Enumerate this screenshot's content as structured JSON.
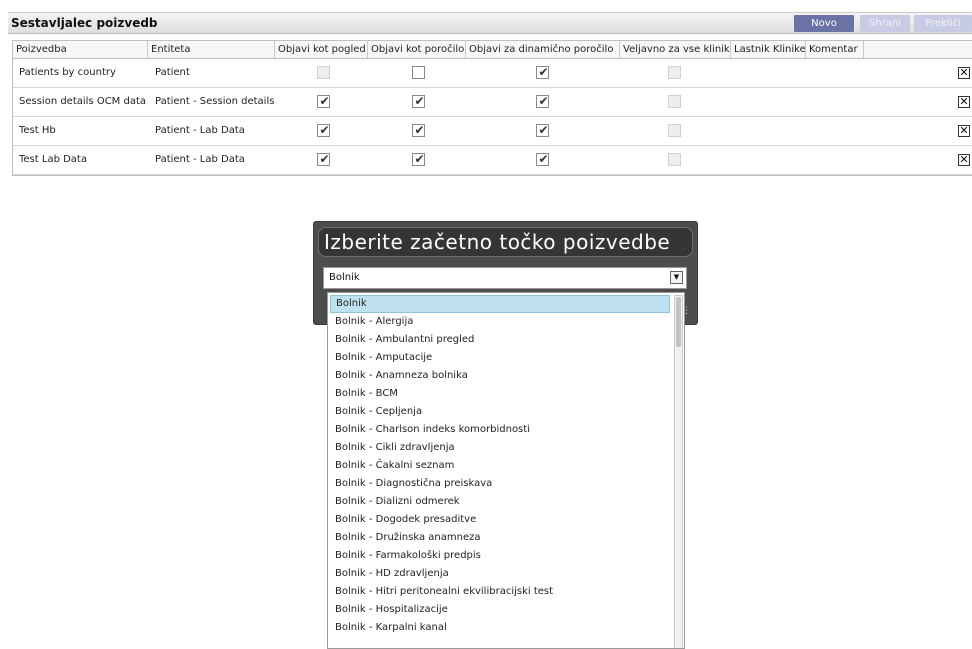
{
  "app": {
    "title": "Sestavljalec poizvedb",
    "buttons": {
      "new": "Novo",
      "save": "Shrani",
      "cancel": "Prekliči"
    }
  },
  "grid": {
    "columns": [
      "Poizvedba",
      "Entiteta",
      "Objavi kot pogled",
      "Objavi kot poročilo",
      "Objavi za dinamično poročilo",
      "Veljavno za vse klinike",
      "Lastnik Klinike",
      "Komentar"
    ],
    "rows": [
      {
        "query": "Patients by country",
        "entity": "Patient",
        "view": false,
        "view_disabled": true,
        "report": false,
        "dynamic": true,
        "all_clinics": false
      },
      {
        "query": "Session details OCM data",
        "entity": "Patient - Session details",
        "view": true,
        "view_disabled": false,
        "report": true,
        "dynamic": true,
        "all_clinics": false
      },
      {
        "query": "Test Hb",
        "entity": "Patient - Lab Data",
        "view": true,
        "view_disabled": false,
        "report": true,
        "dynamic": true,
        "all_clinics": false
      },
      {
        "query": "Test Lab Data",
        "entity": "Patient - Lab Data",
        "view": true,
        "view_disabled": false,
        "report": true,
        "dynamic": true,
        "all_clinics": false
      }
    ],
    "delete_glyph": "✕"
  },
  "dialog": {
    "title": "Izberite začetno točko poizvedbe",
    "selected": "Bolnik",
    "options": [
      "Bolnik",
      "Bolnik - Alergija",
      "Bolnik - Ambulantni pregled",
      "Bolnik - Amputacije",
      "Bolnik - Anamneza bolnika",
      "Bolnik - BCM",
      "Bolnik - Cepljenja",
      "Bolnik - Charlson indeks komorbidnosti",
      "Bolnik - Cikli zdravljenja",
      "Bolnik - Čakalni seznam",
      "Bolnik - Diagnostična preiskava",
      "Bolnik - Dializni odmerek",
      "Bolnik - Dogodek presaditve",
      "Bolnik - Družinska anamneza",
      "Bolnik - Farmakološki predpis",
      "Bolnik - HD zdravljenja",
      "Bolnik - Hitri peritonealni ekvilibracijski test",
      "Bolnik - Hospitalizacije",
      "Bolnik - Karpalni kanal"
    ]
  },
  "colors": {
    "accent": "#6a72a6",
    "selection": "#bfe1ef",
    "dialog_bg": "#4d4d4d"
  }
}
